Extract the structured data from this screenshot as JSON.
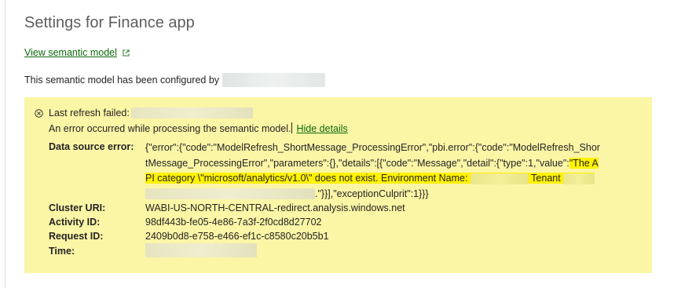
{
  "page": {
    "title": "Settings for Finance app",
    "view_model_link": "View semantic model",
    "configured_text": "This semantic model has been configured by"
  },
  "error": {
    "last_refresh_failed": "Last refresh failed:",
    "message": "An error occurred while processing the semantic model.",
    "hide_details": "Hide details",
    "data_source_error_label": "Data source error:",
    "data_source_lines": {
      "l1": "{\"error\":{\"code\":\"ModelRefresh_ShortMessage_ProcessingError\",\"pbi.error\":{\"code\":\"ModelRefresh_Shor",
      "l2a": "tMessage_ProcessingError\",\"parameters\":{},\"details\":[{\"code\":\"Message\",\"detail\":{\"type\":1,\"value\":",
      "l2b": "\"The A",
      "l3a": "PI category \\\"microsoft/analytics/v1.0\\\" does not exist. Environment Name:",
      "l3b": "Tenant",
      "l4": ".\"}}],\"exceptionCulprit\":1}}}"
    },
    "cluster_uri_label": "Cluster URI:",
    "cluster_uri": "WABI-US-NORTH-CENTRAL-redirect.analysis.windows.net",
    "activity_id_label": "Activity ID:",
    "activity_id": "98df443b-fe05-4e86-7a3f-2f0cd8d27702",
    "request_id_label": "Request ID:",
    "request_id": "2409b0d8-e758-e466-ef1c-c8580c20b5b1",
    "time_label": "Time:"
  },
  "colors": {
    "error_background": "#fbf5a6",
    "highlight": "#fff200",
    "link": "#0b6a0b"
  },
  "icons": {
    "external_link": "external-link-icon",
    "error": "error-circle-x-icon"
  }
}
